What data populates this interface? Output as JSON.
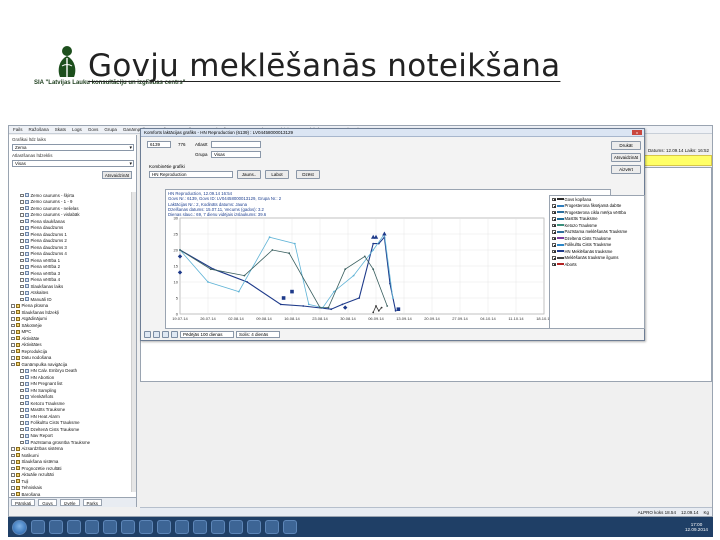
{
  "slide": {
    "title": "Govju meklēšanās noteikšana",
    "logo_text": "SIA \"Latvijas Lauku konsultāciju un izglītības centrs\""
  },
  "app": {
    "menu": [
      "Fails",
      "Ražošana",
      "Skats",
      "Logs",
      "Govs",
      "Grupa",
      "Ganāmpulks",
      "Barošana",
      "Barošana",
      "Govs kopšana",
      "Iestatīt",
      "Ekstra",
      "Aktivitātes",
      "Palīdzība",
      "Parametri",
      "Piemērota programma"
    ],
    "left_panel": {
      "label1": "Grafikai līdz laiks",
      "select1": "Zema",
      "label2": "Atlasīšanas līdzeklis",
      "select2": "Visas",
      "button": "Atsvaidzināt",
      "tree": [
        {
          "label": "Zemo caurums - šķirta",
          "ico": "doc"
        },
        {
          "label": "Zemo caurums - 1 - 9",
          "ico": "doc"
        },
        {
          "label": "Zemo caurums - nelielas",
          "ico": "doc"
        },
        {
          "label": "Zemo caurums - vislabāk",
          "ico": "doc"
        },
        {
          "label": "Piena slaukšanas",
          "ico": "doc"
        },
        {
          "label": "Piena daudzums",
          "ico": "doc"
        },
        {
          "label": "Piena daudzums 1",
          "ico": "doc"
        },
        {
          "label": "Piena daudzums 2",
          "ico": "doc"
        },
        {
          "label": "Piena daudzums 3",
          "ico": "doc"
        },
        {
          "label": "Piena daudzums 4",
          "ico": "doc"
        },
        {
          "label": "Piena vērtība 1",
          "ico": "doc"
        },
        {
          "label": "Piena vērtība 2",
          "ico": "doc"
        },
        {
          "label": "Piena vērtība 3",
          "ico": "doc"
        },
        {
          "label": "Piena vērtība 4",
          "ico": "doc"
        },
        {
          "label": "Slaukšanas laiks",
          "ico": "doc"
        },
        {
          "label": "Atskaites",
          "ico": "doc"
        },
        {
          "label": "Manuāli ID",
          "ico": "doc"
        },
        {
          "label": "Piena plūsma",
          "ico": "folder"
        },
        {
          "label": "Slaukšanas līdzekļi",
          "ico": "folder"
        },
        {
          "label": "Atgādinājumi",
          "ico": "folder"
        },
        {
          "label": "Sākotnējie",
          "ico": "folder"
        },
        {
          "label": "MPC",
          "ico": "folder"
        },
        {
          "label": "Aktivitāte",
          "ico": "folder"
        },
        {
          "label": "Aktivitātes",
          "ico": "folder"
        },
        {
          "label": "Reprodukcija",
          "ico": "folder"
        },
        {
          "label": "Datu nodošana",
          "ico": "folder"
        },
        {
          "label": "Ganāmpulka navigācija",
          "ico": "folder"
        },
        {
          "label": "HN Calv. Embryo Death",
          "ico": "doc"
        },
        {
          "label": "HN Abortion",
          "ico": "doc"
        },
        {
          "label": "HN Pregnant list",
          "ico": "doc"
        },
        {
          "label": "HN Sampling",
          "ico": "doc"
        },
        {
          "label": "Vienkāršots",
          "ico": "doc"
        },
        {
          "label": "Ketozo Trauksme",
          "ico": "doc"
        },
        {
          "label": "Mastīts Trauksme",
          "ico": "doc"
        },
        {
          "label": "HN Heat Alarm",
          "ico": "doc"
        },
        {
          "label": "Folikulītu Cists Trauksme",
          "ico": "doc"
        },
        {
          "label": "Dzeltenā Cists Trauksme",
          "ico": "doc"
        },
        {
          "label": "Nav Report",
          "ico": "doc"
        },
        {
          "label": "Pazīstama grūsnība Trauksme",
          "ico": "doc"
        },
        {
          "label": "Aizsardzības sistēma",
          "ico": "folder"
        },
        {
          "label": "Notikumi",
          "ico": "folder"
        },
        {
          "label": "Slaukšana sistēma",
          "ico": "folder"
        },
        {
          "label": "Prognozētie rezultāti",
          "ico": "folder"
        },
        {
          "label": "Aktuālie rezultāti",
          "ico": "folder"
        },
        {
          "label": "Tuļi",
          "ico": "folder"
        },
        {
          "label": "Tehniskais",
          "ico": "folder"
        },
        {
          "label": "Barošana",
          "ico": "folder"
        },
        {
          "label": "Piliens",
          "ico": "folder"
        },
        {
          "label": "Cietie",
          "ico": "folder"
        },
        {
          "label": "Visi",
          "ico": "folder"
        }
      ],
      "tabs": [
        "Pārskati",
        "Govs",
        "Izvēle",
        "Parks"
      ]
    },
    "toolbar": {
      "select1": "Visas",
      "select2": "Visas govis"
    },
    "header_strip": {
      "left": "Laukums: SIA",
      "center": "HN Heat Alarm",
      "right": "Datums: 12.09.14 Laiks: 16:52"
    },
    "yellow": {
      "line1": "Grupa: Visas ; Atlasīt: Visas govis",
      "line2": "Pārskaiti: 5"
    },
    "grid": {
      "headers": [
        "Govs Nr.",
        "Grupa Nr.",
        "Laktācijas Nr.",
        "Dienas slauc.",
        "7 dienu vidējais izslaukums",
        "Kodināts datums",
        "Dienas kopš atklāšanas",
        "Iepriekšējā meklēš.",
        "HN Meklēšanās trauksme",
        "Vērtība pēdējām sekundēm",
        "HN Heat Hours Since Alarm",
        "Gaidāmā ovulācija",
        "Dzeltenā Cists Trauksme",
        "Aptuvenais atslauktais izslauks",
        "Aptuvenais atslauktais izslauks 2",
        "Dienas nogaidīt",
        "Pirmais sols; rikari izslaukums"
      ],
      "rows": [
        [
          "6684",
          "2",
          "1",
          "46",
          "29.0",
          "Jauna",
          "-",
          "-",
          "J8",
          "76",
          "11",
          "6.49",
          "-",
          "-",
          "-",
          "-",
          "-"
        ],
        [
          "5494",
          "2",
          "1",
          "57",
          "33.0",
          "Jauna",
          "-",
          "-",
          "J8",
          "82",
          "35",
          "6.58",
          "-",
          "-",
          "-",
          "-",
          "-"
        ],
        [
          "4588",
          "1",
          "1",
          "27",
          "27.5",
          "Jauna",
          "-",
          "-",
          "J8",
          "42",
          "35",
          "6.47",
          "-",
          "-",
          "-",
          "-",
          "-"
        ],
        [
          "4670",
          "2",
          "1",
          "54",
          "34.5",
          "Jauna",
          "-",
          "-",
          "J8",
          "82",
          "55",
          "6.54",
          "-",
          "-",
          "-",
          "-",
          "-"
        ],
        [
          "4119",
          "2",
          "2",
          "68",
          "39.6",
          "Jauna",
          "-",
          "-",
          "J8",
          "83",
          "57",
          "6.23",
          "-",
          "-",
          "-",
          "-",
          "-"
        ]
      ]
    },
    "dialog": {
      "title": "Komforts laktācijas grafiks - HN Reproduction (6139) : LV04458000013129",
      "close": "x",
      "cow_no": "6139",
      "number2": "776",
      "atlasit_label": "Atlasīt",
      "atlasit_value": "",
      "grupa_label": "Grupa",
      "grupa_value": "Visas",
      "kombinetie_label": "Kombinētie grafiki",
      "kombinetie_value": "HN Reproduction",
      "btn_jauns": "Jauns..",
      "btn_labot": "Labot",
      "btn_dzest": "Dzēst",
      "btn_drukat": "Drukāt",
      "btn_atsvaidzinat": "Atsvaidzināt",
      "btn_aizvert": "Aizvērt",
      "plot_info": [
        "HN Reproduction, 12.09.14 16:54",
        "Govs Nr.: 6139, Govs ID: LV04458000013129, Grupa Nr.: 2",
        "Laktācijas Nr.: 2, Kodināts datums: Jauna",
        "Dzelšanas datums: 15.07.11, Vecums (gados): 3.2",
        "Dienas slauc.: 69, 7 dienu vidējais izslaukums: 39.6"
      ],
      "bottom_select1": "Pēdējās 100 dienas",
      "bottom_select2": "Solis: 4 dienās"
    },
    "status": {
      "left": "ALPRO koks 18.54",
      "right": "12.09.14",
      "ks": "Kg"
    },
    "clock": {
      "time": "17:00",
      "date": "12.09.2014"
    }
  },
  "chart_data": {
    "type": "line",
    "x_ticks": [
      "19.07.14",
      "26.07.14",
      "02.08.14",
      "09.08.14",
      "16.08.14",
      "23.08.14",
      "30.08.14",
      "06.09.14",
      "13.09.14",
      "20.09.14",
      "27.09.14",
      "04.10.14",
      "11.10.14",
      "18.10.14"
    ],
    "y_ticks": [
      "0",
      "5",
      "10",
      "15",
      "20",
      "25",
      "30"
    ],
    "ylim": [
      0,
      30
    ],
    "xlim": [
      0,
      13
    ],
    "series": [
      {
        "color": "#1e3a8a",
        "x": [
          0.0,
          1.2,
          2.4,
          3.6,
          4.4,
          5.4,
          5.8,
          6.4,
          6.9,
          7.1,
          7.3,
          7.5,
          7.7
        ],
        "values": [
          20.0,
          14.0,
          10.0,
          3.0,
          2.5,
          1.5,
          3.0,
          5.0,
          22.0,
          22.0,
          24.0,
          9.5,
          1.0
        ]
      },
      {
        "color": "#5fb3d6",
        "x": [
          0.0,
          1.0,
          2.1,
          3.2,
          4.1,
          4.6,
          5.1,
          5.5,
          6.2,
          6.9,
          7.3,
          7.6
        ],
        "values": [
          20.0,
          10.0,
          7.0,
          24.0,
          22.0,
          3.0,
          2.0,
          7.0,
          12.0,
          20.0,
          25.0,
          5.0
        ]
      },
      {
        "color": "#3a5f5f",
        "x": [
          0.0,
          1.1,
          2.3,
          3.3,
          3.9,
          5.0,
          5.3,
          5.9,
          6.6,
          6.9,
          7.4
        ],
        "values": [
          20.0,
          14.0,
          12.0,
          20.0,
          19.0,
          2.0,
          2.0,
          14.0,
          18.0,
          14.0,
          2.5
        ]
      },
      {
        "color": "#333333",
        "x": [
          6.9,
          7.0,
          7.1,
          7.2
        ],
        "values": [
          0.5,
          2.5,
          1.0,
          2.0
        ]
      }
    ],
    "markers": {
      "triangles_up": {
        "color": "#1e3a8a",
        "x": [
          6.9,
          7.0,
          7.3
        ],
        "values": [
          24.0,
          24.0,
          25.0
        ]
      },
      "diamonds": {
        "color": "#1e3a8a",
        "x": [
          0.0,
          0.0,
          5.9
        ],
        "values": [
          18.0,
          13.0,
          2.0
        ]
      },
      "squares": {
        "color": "#1e3a8a",
        "x": [
          3.7,
          4.0,
          7.8
        ],
        "values": [
          5.0,
          7.0,
          1.5
        ]
      }
    },
    "legend": [
      {
        "label": "Govs kopšana",
        "color": "#2b2b2b"
      },
      {
        "label": "Progesterona fiksējamā dabīte",
        "color": "#2e7dbd"
      },
      {
        "label": "Progesterona cikla mērķa vērtība",
        "color": "#2b6f9f"
      },
      {
        "label": "Mastīts Trauksme",
        "color": "#1a6b98"
      },
      {
        "label": "Ketozo Trauksme",
        "color": "#3a8f7c"
      },
      {
        "label": "Pazīstama meklēšanās Trauksme",
        "color": "#2f6f9d"
      },
      {
        "label": "Dzeltenā Cists Trauksme",
        "color": "#7a3c9e"
      },
      {
        "label": "Folikulītu Cists Trauksme",
        "color": "#2b86c7"
      },
      {
        "label": "HN Meklēšanās trauksme",
        "color": "#1e3a8a"
      },
      {
        "label": "Meklēšanās trauksme ilgums",
        "color": "#444444"
      },
      {
        "label": "Aborts",
        "color": "#b22222"
      }
    ]
  }
}
